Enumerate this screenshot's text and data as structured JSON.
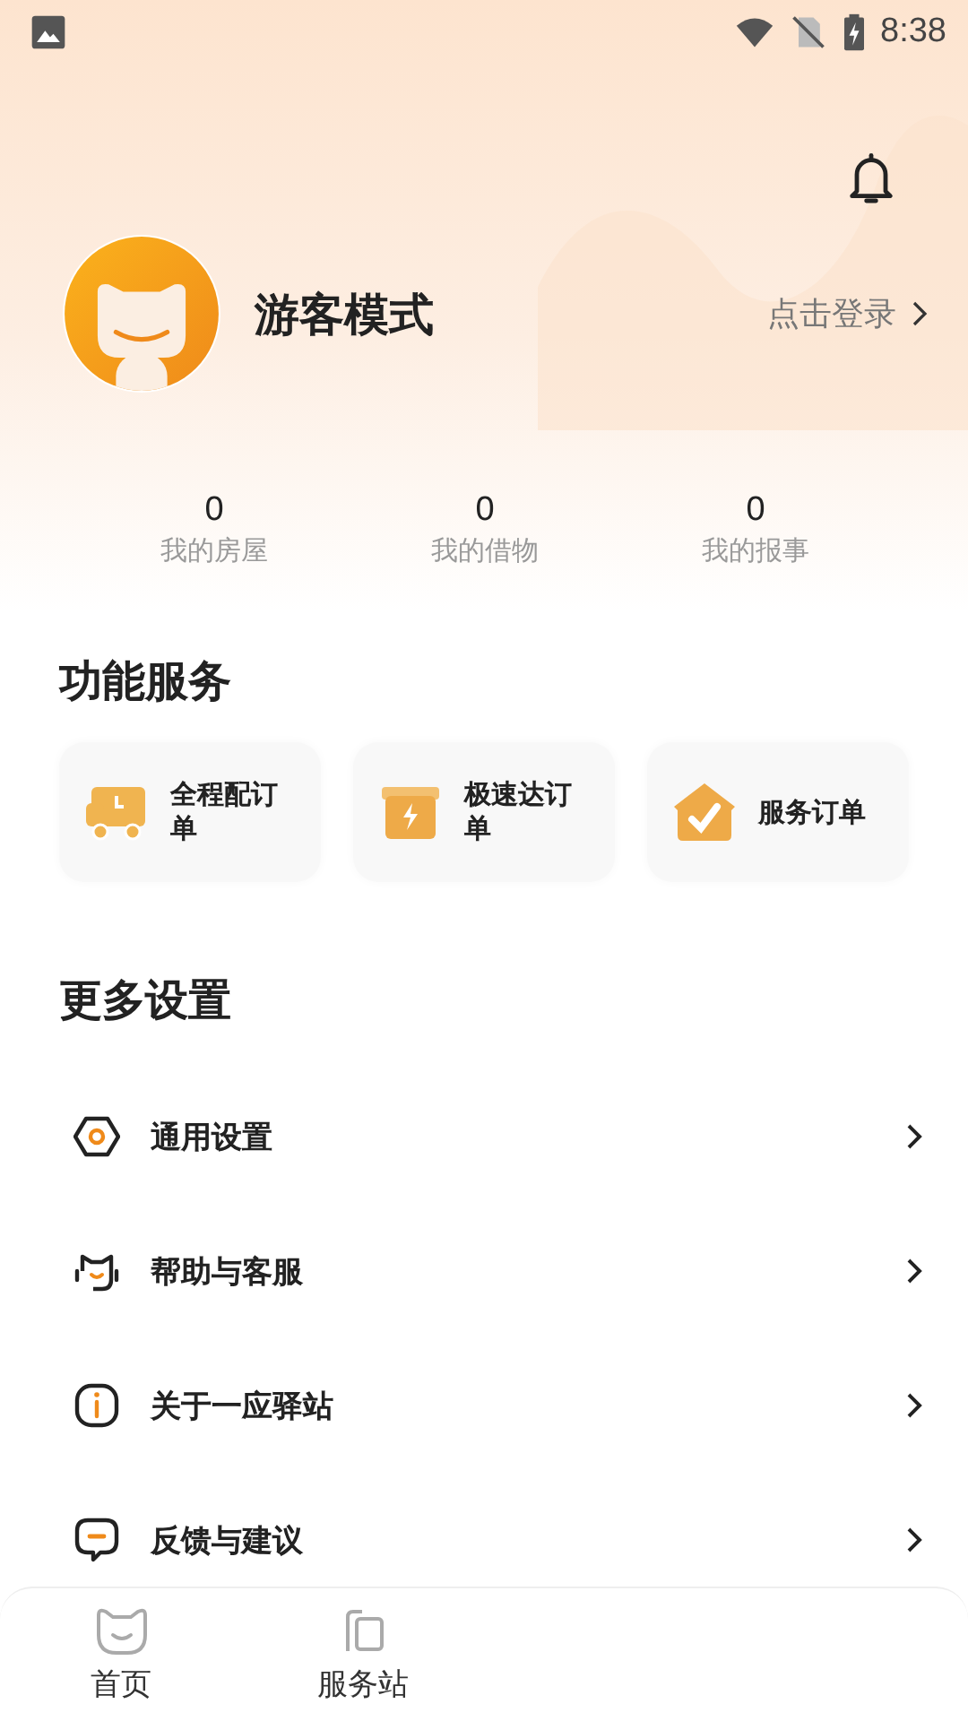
{
  "status_bar": {
    "time": "8:38"
  },
  "profile": {
    "name": "游客模式",
    "login_link": "点击登录"
  },
  "stats": [
    {
      "value": "0",
      "label": "我的房屋"
    },
    {
      "value": "0",
      "label": "我的借物"
    },
    {
      "value": "0",
      "label": "我的报事"
    }
  ],
  "services": {
    "title": "功能服务",
    "items": [
      {
        "kind": "truck",
        "label": "全程配订单"
      },
      {
        "kind": "box",
        "label": "极速达订单"
      },
      {
        "kind": "house",
        "label": "服务订单"
      }
    ]
  },
  "settings": {
    "title": "更多设置",
    "items": [
      {
        "kind": "gear",
        "label": "通用设置"
      },
      {
        "kind": "headset",
        "label": "帮助与客服"
      },
      {
        "kind": "info",
        "label": "关于一应驿站"
      },
      {
        "kind": "feedback",
        "label": "反馈与建议"
      }
    ]
  },
  "bottom_nav": [
    {
      "kind": "home",
      "label": "首页",
      "selected": false
    },
    {
      "kind": "station",
      "label": "服务站",
      "selected": false
    }
  ]
}
